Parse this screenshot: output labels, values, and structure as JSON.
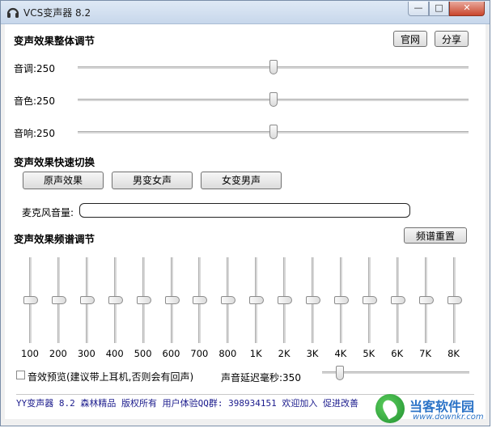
{
  "window": {
    "title": "VCS变声器 8.2",
    "min_glyph": "—",
    "max_glyph": "□",
    "close_glyph": "✕"
  },
  "overall": {
    "section_title": "变声效果整体调节",
    "official_button": "官网",
    "share_button": "分享",
    "sliders": [
      {
        "label": "音调:250",
        "value": 250,
        "max": 500
      },
      {
        "label": "音色:250",
        "value": 250,
        "max": 500
      },
      {
        "label": "音响:250",
        "value": 250,
        "max": 500
      }
    ]
  },
  "quick": {
    "section_title": "变声效果快速切换",
    "buttons": [
      "原声效果",
      "男变女声",
      "女变男声"
    ],
    "mic_label": "麦克风音量:",
    "mic_level": 0
  },
  "eq": {
    "section_title": "变声效果频谱调节",
    "reset_button": "频谱重置",
    "bands": [
      {
        "label": "100",
        "value": 0.5
      },
      {
        "label": "200",
        "value": 0.5
      },
      {
        "label": "300",
        "value": 0.5
      },
      {
        "label": "400",
        "value": 0.5
      },
      {
        "label": "500",
        "value": 0.5
      },
      {
        "label": "600",
        "value": 0.5
      },
      {
        "label": "700",
        "value": 0.5
      },
      {
        "label": "800",
        "value": 0.5
      },
      {
        "label": "1K",
        "value": 0.5
      },
      {
        "label": "2K",
        "value": 0.5
      },
      {
        "label": "3K",
        "value": 0.5
      },
      {
        "label": "4K",
        "value": 0.5
      },
      {
        "label": "5K",
        "value": 0.5
      },
      {
        "label": "6K",
        "value": 0.5
      },
      {
        "label": "7K",
        "value": 0.5
      },
      {
        "label": "8K",
        "value": 0.5
      }
    ]
  },
  "preview": {
    "checkbox_label": "音效预览(建议带上耳机,否则会有回声)",
    "checked": false,
    "delay_label": "声音延迟毫秒:350",
    "delay_value": 350,
    "delay_max": 3500
  },
  "status": {
    "text": "YY变声器 8.2 森林精品 版权所有 用户体验QQ群: 398934151 欢迎加入 促进改善"
  },
  "watermark": {
    "text": "当客软件园",
    "url": "www.downkr.com"
  }
}
